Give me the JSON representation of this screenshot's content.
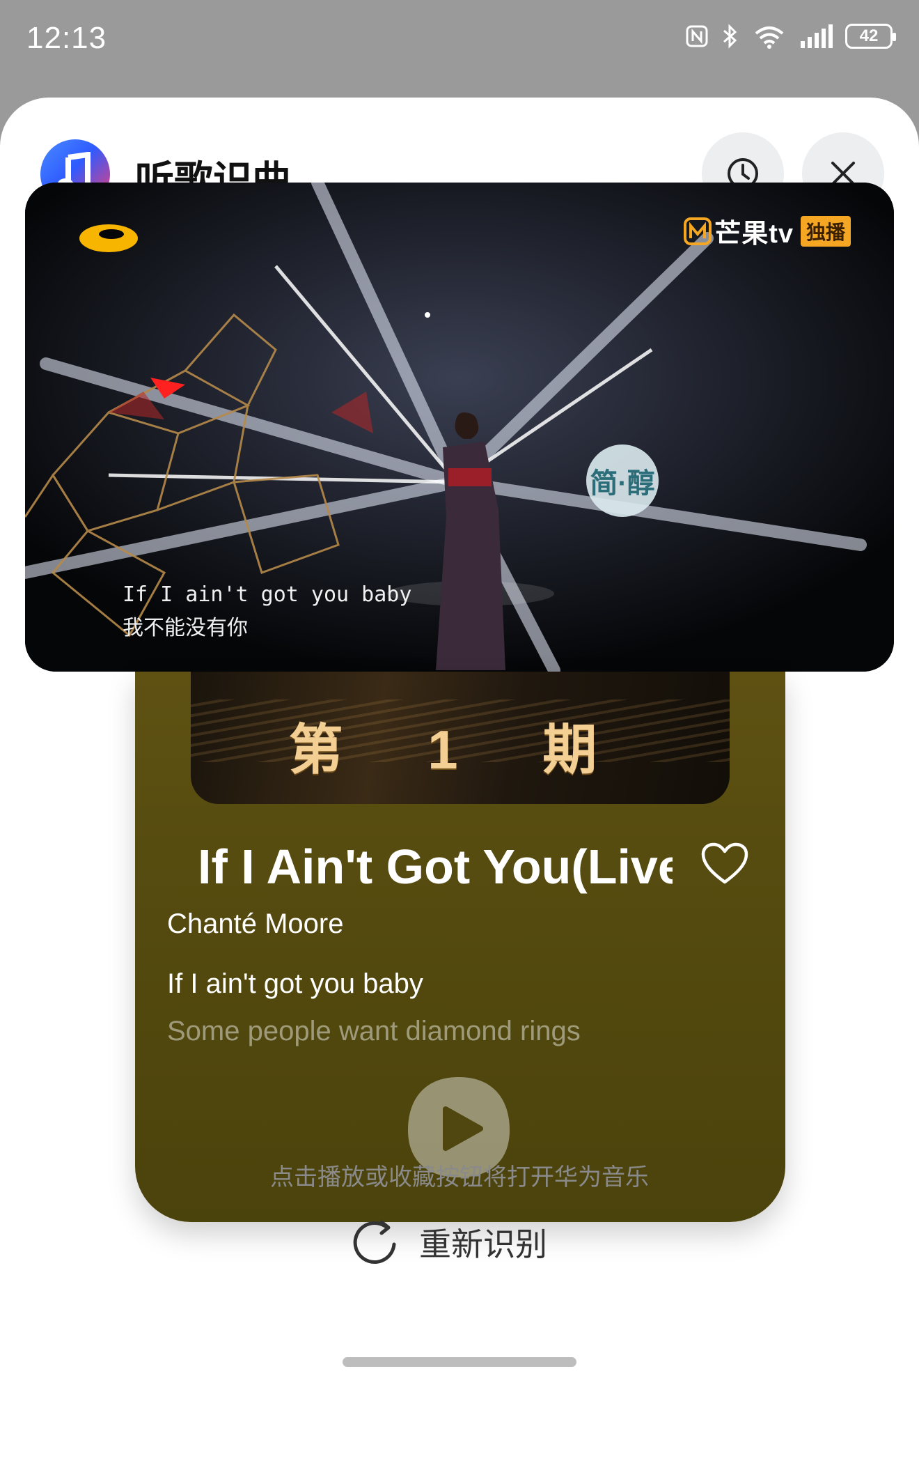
{
  "status_bar": {
    "time": "12:13",
    "battery": "42",
    "icons": [
      "nfc-icon",
      "bluetooth-icon",
      "wifi-icon",
      "signal-icon",
      "battery-icon"
    ]
  },
  "header": {
    "app_title": "听歌识曲",
    "history_icon": "clock-icon",
    "close_icon": "close-icon"
  },
  "video": {
    "channel_name": "芒果tv",
    "channel_badge": "独播",
    "sponsor": "简·醇",
    "subtitle_en": "If I ain't got you baby",
    "subtitle_zh": "我不能没有你"
  },
  "song": {
    "cover_label": "第 1 期",
    "title": "If I Ain't Got You(Live)",
    "artist": "Chanté Moore",
    "lyric_current": "If I ain't got you baby",
    "lyric_next": "Some people want diamond rings"
  },
  "hint": "点击播放或收藏按钮将打开华为音乐",
  "retry_label": "重新识别",
  "colors": {
    "card_bg": "#544a0f",
    "accent_gold": "#f3cf94"
  }
}
